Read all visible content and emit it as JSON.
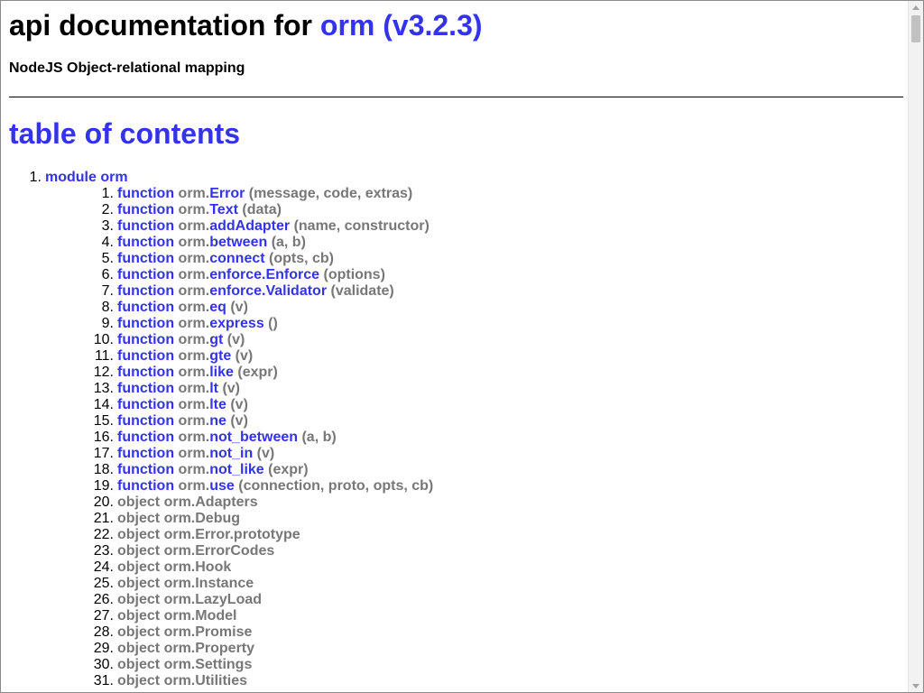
{
  "header": {
    "title_prefix": "api documentation for ",
    "title_module": "orm (v3.2.3)",
    "subtitle": "NodeJS Object-relational mapping"
  },
  "toc": {
    "heading": "table of contents",
    "module": {
      "number": "1.",
      "label": "module orm"
    },
    "items": [
      {
        "number": "1.",
        "kind": "function",
        "prefix": "orm.",
        "name": "Error",
        "args": "(message, code, extras)"
      },
      {
        "number": "2.",
        "kind": "function",
        "prefix": "orm.",
        "name": "Text",
        "args": "(data)"
      },
      {
        "number": "3.",
        "kind": "function",
        "prefix": "orm.",
        "name": "addAdapter",
        "args": "(name, constructor)"
      },
      {
        "number": "4.",
        "kind": "function",
        "prefix": "orm.",
        "name": "between",
        "args": "(a, b)"
      },
      {
        "number": "5.",
        "kind": "function",
        "prefix": "orm.",
        "name": "connect",
        "args": "(opts, cb)"
      },
      {
        "number": "6.",
        "kind": "function",
        "prefix": "orm.",
        "name": "enforce.Enforce",
        "args": "(options)"
      },
      {
        "number": "7.",
        "kind": "function",
        "prefix": "orm.",
        "name": "enforce.Validator",
        "args": "(validate)"
      },
      {
        "number": "8.",
        "kind": "function",
        "prefix": "orm.",
        "name": "eq",
        "args": "(v)"
      },
      {
        "number": "9.",
        "kind": "function",
        "prefix": "orm.",
        "name": "express",
        "args": "()"
      },
      {
        "number": "10.",
        "kind": "function",
        "prefix": "orm.",
        "name": "gt",
        "args": "(v)"
      },
      {
        "number": "11.",
        "kind": "function",
        "prefix": "orm.",
        "name": "gte",
        "args": "(v)"
      },
      {
        "number": "12.",
        "kind": "function",
        "prefix": "orm.",
        "name": "like",
        "args": "(expr)"
      },
      {
        "number": "13.",
        "kind": "function",
        "prefix": "orm.",
        "name": "lt",
        "args": "(v)"
      },
      {
        "number": "14.",
        "kind": "function",
        "prefix": "orm.",
        "name": "lte",
        "args": "(v)"
      },
      {
        "number": "15.",
        "kind": "function",
        "prefix": "orm.",
        "name": "ne",
        "args": "(v)"
      },
      {
        "number": "16.",
        "kind": "function",
        "prefix": "orm.",
        "name": "not_between",
        "args": "(a, b)"
      },
      {
        "number": "17.",
        "kind": "function",
        "prefix": "orm.",
        "name": "not_in",
        "args": "(v)"
      },
      {
        "number": "18.",
        "kind": "function",
        "prefix": "orm.",
        "name": "not_like",
        "args": "(expr)"
      },
      {
        "number": "19.",
        "kind": "function",
        "prefix": "orm.",
        "name": "use",
        "args": "(connection, proto, opts, cb)"
      }
    ],
    "objects": [
      {
        "number": "20.",
        "label": "object orm.Adapters"
      },
      {
        "number": "21.",
        "label": "object orm.Debug"
      },
      {
        "number": "22.",
        "label": "object orm.Error.prototype"
      },
      {
        "number": "23.",
        "label": "object orm.ErrorCodes"
      },
      {
        "number": "24.",
        "label": "object orm.Hook"
      },
      {
        "number": "25.",
        "label": "object orm.Instance"
      },
      {
        "number": "26.",
        "label": "object orm.LazyLoad"
      },
      {
        "number": "27.",
        "label": "object orm.Model"
      },
      {
        "number": "28.",
        "label": "object orm.Promise"
      },
      {
        "number": "29.",
        "label": "object orm.Property"
      },
      {
        "number": "30.",
        "label": "object orm.Settings"
      },
      {
        "number": "31.",
        "label": "object orm.Utilities"
      }
    ]
  },
  "scrollbar": {
    "up_icon": "triangle-up",
    "down_icon": "triangle-down"
  },
  "colors": {
    "link": "#3333ee",
    "muted": "#777777"
  }
}
